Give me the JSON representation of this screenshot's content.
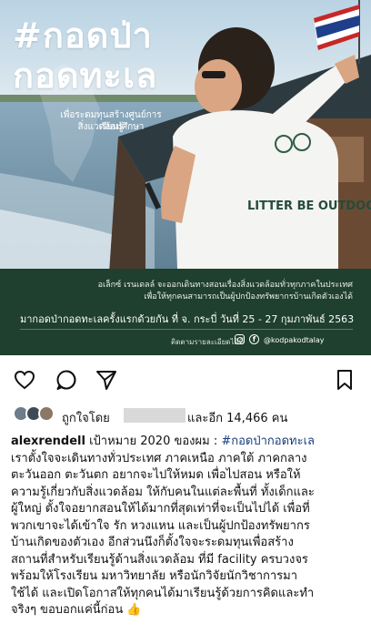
{
  "post_image": {
    "hashtag_line1": "#กอดป่า",
    "hashtag_line2": "กอดทะเล",
    "subtitle_line1": "เพื่อระดมทุนสร้างศูนย์การเรียนรู้",
    "subtitle_line2": "สิ่งแวดล้อมศึกษา",
    "shirt_text": "LITTER BE OUTDOOR",
    "banner_line1": "อเล็กซ์ เรนเดลล์ จะออกเดินทางสอนเรื่องสิ่งแวดล้อมทั่วทุกภาคในประเทศ",
    "banner_line2": "เพื่อให้ทุกคนสามารถเป็นผู้ปกป้องทรัพยากรบ้านเกิดตัวเองได้",
    "banner_line3": "มากอดป่ากอดทะเลครั้งแรกด้วยกัน ที่ จ. กระบี่ วันที่ 25 - 27 กุมภาพันธ์ 2563",
    "follow_text": "ติดตามรายละเอียดได้ที่",
    "social_handle": "@kodpakodtalay",
    "colors": {
      "banner": "#1f3f2f",
      "sky": "#a9c6da",
      "sea": "#7f9fb3"
    }
  },
  "actions": {
    "like_icon": "heart-icon",
    "comment_icon": "comment-icon",
    "share_icon": "share-icon",
    "save_icon": "bookmark-icon"
  },
  "likes": {
    "prefix": "ถูกใจโดย",
    "suffix": "และอีก 14,466 คน"
  },
  "caption": {
    "username": "alexrendell",
    "intro": " เป้าหมาย 2020 ของผม : ",
    "hashtag": "#กอดป่ากอดทะเล",
    "lines": [
      "เราตั้งใจจะเดินทางทั่วประเทศ ภาคเหนือ ภาคใต้ ภาคกลาง",
      "ตะวันออก ตะวันตก อยากจะไปให้หมด เพื่อไปสอน หรือให้",
      "ความรู้เกี่ยวกับสิ่งแวดล้อม ให้กับคนในแต่ละพื้นที่ ทั้งเด็กและ",
      "ผู้ใหญ่ ตั้งใจอยากสอนให้ได้มากที่สุดเท่าที่จะเป็นไปได้ เพื่อที่",
      "พวกเขาจะได้เข้าใจ รัก หวงแหน และเป็นผู้ปกป้องทรัพยากร",
      "บ้านเกิดของตัวเอง อีกส่วนนึงก็ตั้งใจจะระดมทุนเพื่อสร้าง",
      "สถานที่สำหรับเรียนรู้ด้านสิ่งแวดล้อม ที่มี facility ครบวงจร",
      "พร้อมให้โรงเรียน มหาวิทยาลัย หรือนักวิจัยนักวิชาการมา",
      "ใช้ได้ และเปิดโอกาสให้ทุกคนได้มาเรียนรู้ด้วยการคิดและทำ",
      "จริงๆ ขอบอกแค่นี้ก่อน 👍"
    ]
  }
}
